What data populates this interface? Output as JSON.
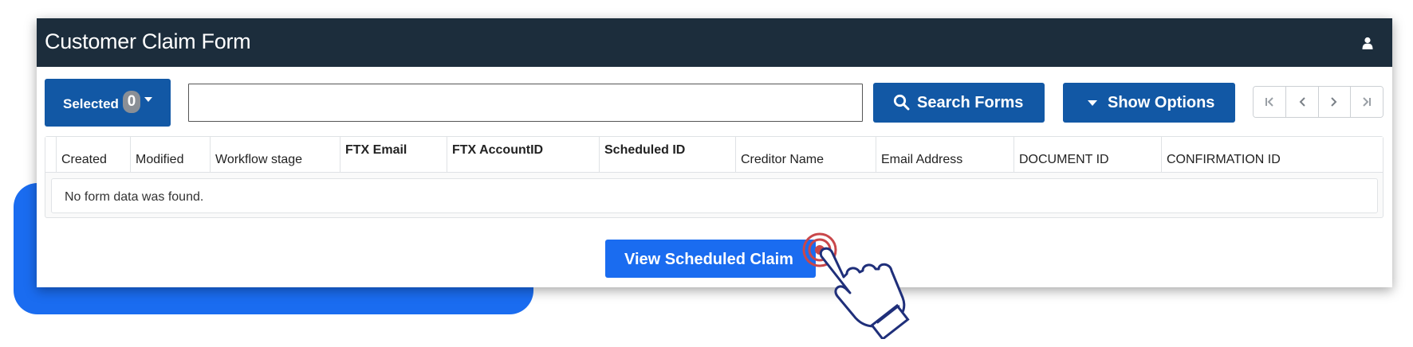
{
  "window": {
    "title": "Customer Claim Form"
  },
  "toolbar": {
    "selected_label": "Selected",
    "selected_count": "0",
    "search_value": "",
    "search_button_label": "Search Forms",
    "options_button_label": "Show Options"
  },
  "pager": {
    "icons": [
      "first-page-icon",
      "previous-page-icon",
      "next-page-icon",
      "last-page-icon"
    ]
  },
  "table": {
    "columns": [
      "Created",
      "Modified",
      "Workflow stage",
      "FTX Email",
      "FTX AccountID",
      "Scheduled ID",
      "Creditor Name",
      "Email Address",
      "DOCUMENT ID",
      "CONFIRMATION ID"
    ],
    "empty_message": "No form data was found."
  },
  "action": {
    "view_button_label": "View Scheduled Claim"
  },
  "colors": {
    "titlebar": "#1c2d3c",
    "primary_button": "#1258a5",
    "accent": "#1a6cf0"
  }
}
